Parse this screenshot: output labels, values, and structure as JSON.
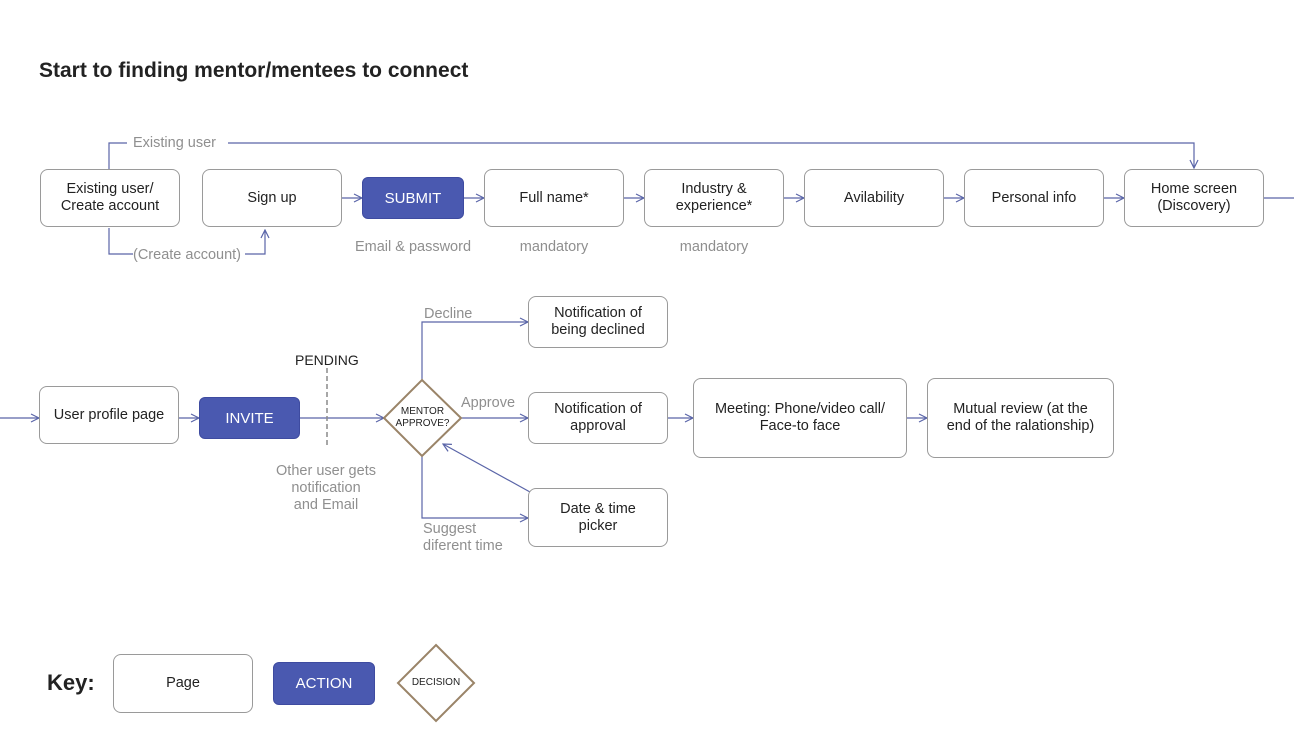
{
  "title": "Start to finding mentor/mentees to connect",
  "colors": {
    "connector": "#5a65a8",
    "action_fill": "#4a59b0",
    "decision_stroke": "#9a8468",
    "note_text": "#8f8f8f",
    "page_border": "#9a9a9a"
  },
  "row1": {
    "existing_or_create": "Existing user/\nCreate account",
    "sign_up": "Sign up",
    "submit": "SUBMIT",
    "full_name": "Full name*",
    "industry": "Industry &\nexperience*",
    "availability": "Avilability",
    "personal_info": "Personal info",
    "home_screen": "Home screen\n(Discovery)",
    "existing_user_label": "Existing user",
    "create_account_label": "(Create account)",
    "submit_note": "Email & password",
    "full_name_note": "mandatory",
    "industry_note": "mandatory"
  },
  "row2": {
    "user_profile": "User profile page",
    "invite": "INVITE",
    "pending": "PENDING",
    "pending_note": "Other user gets\nnotification\nand Email",
    "decision": "MENTOR\nAPPROVE?",
    "decline_label": "Decline",
    "approve_label": "Approve",
    "suggest_label": "Suggest\ndiferent time",
    "declined_notification": "Notification of\nbeing declined",
    "approval_notification": "Notification of\napproval",
    "date_time_picker": "Date & time\npicker",
    "meeting": "Meeting: Phone/video call/\nFace-to face",
    "mutual_review": "Mutual review (at the\nend of the ralationship)"
  },
  "key": {
    "label": "Key:",
    "page": "Page",
    "action": "ACTION",
    "decision": "DECISION"
  }
}
